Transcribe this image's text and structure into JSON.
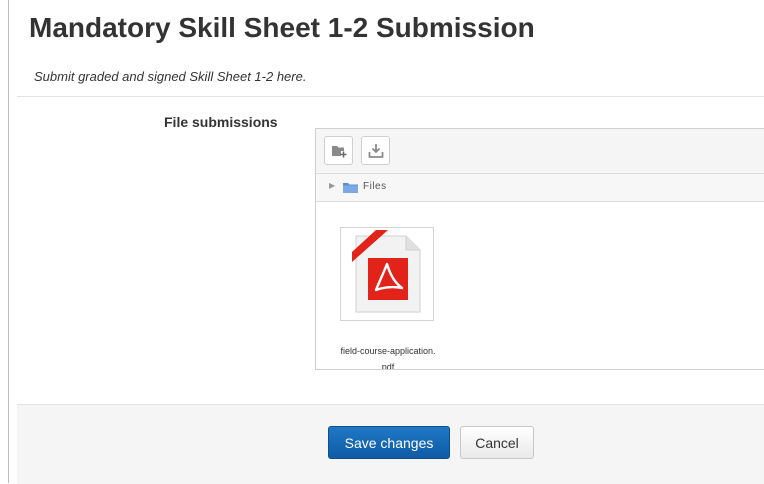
{
  "page": {
    "title": "Mandatory Skill Sheet 1-2 Submission",
    "intro": "Submit graded and signed Skill Sheet 1-2 here."
  },
  "form": {
    "file_submissions_label": "File submissions"
  },
  "filemanager": {
    "toolbar": {
      "add_icon": "folder-add-icon",
      "download_icon": "download-icon"
    },
    "path": {
      "label": "Files"
    },
    "files": [
      {
        "name": "field-course-application.pdf",
        "type": "pdf",
        "icon": "pdf-file-icon"
      }
    ]
  },
  "actions": {
    "save_label": "Save changes",
    "cancel_label": "Cancel"
  },
  "colors": {
    "primary_button": "#1a6bb8",
    "pdf_red": "#e2231a"
  }
}
